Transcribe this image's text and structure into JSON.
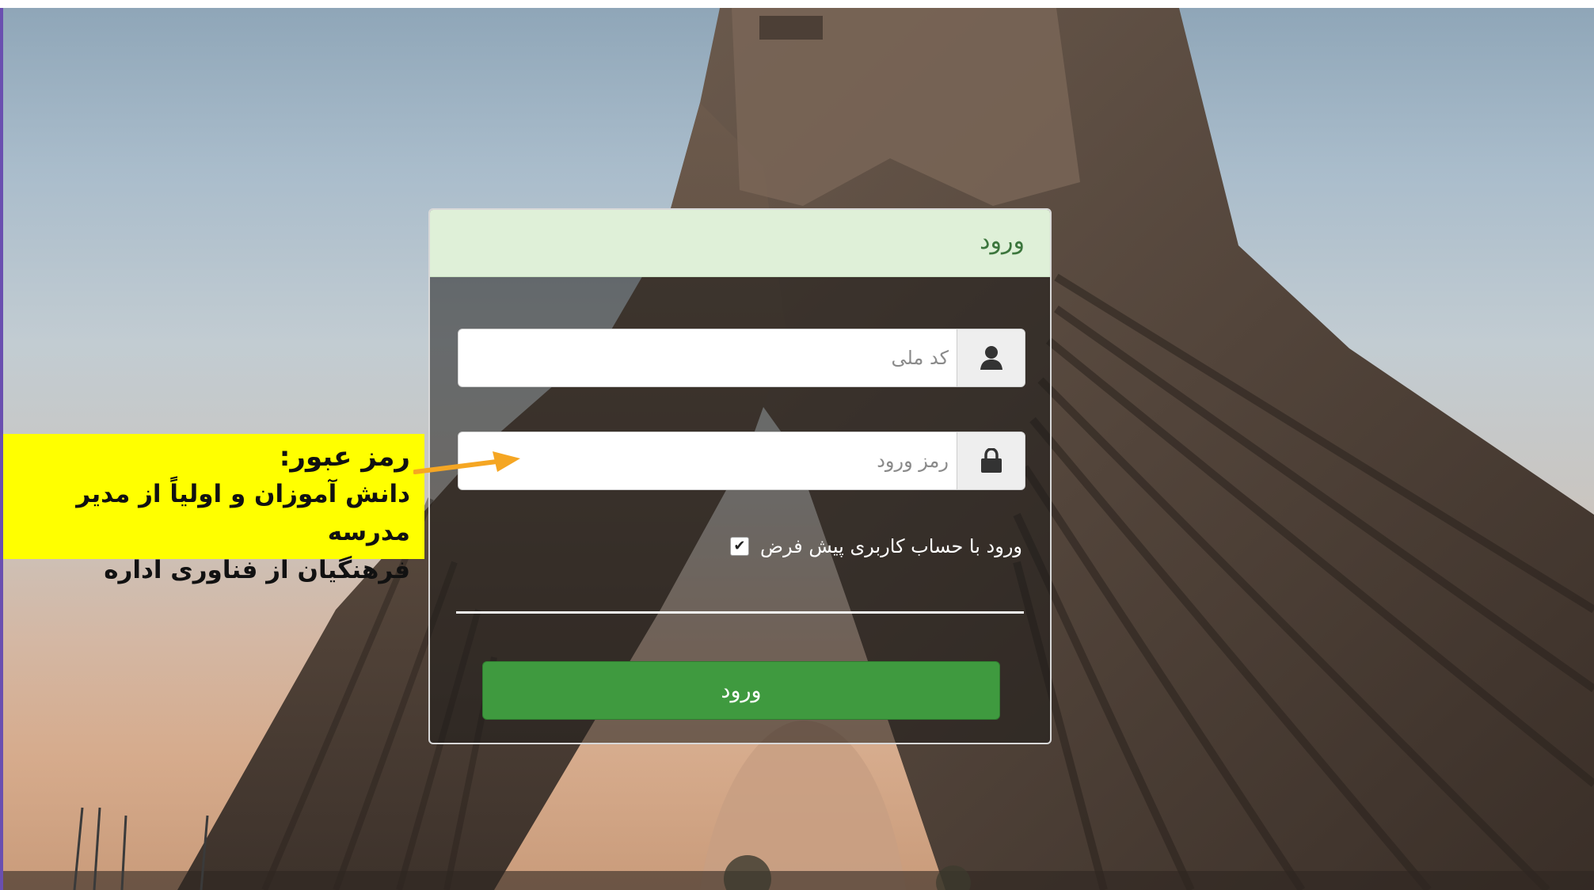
{
  "login": {
    "title": "ورود",
    "national_code_placeholder": "کد ملی",
    "password_placeholder": "رمز ورود",
    "remember_label": "ورود با حساب کاربری پیش فرض",
    "remember_checked": true,
    "submit_label": "ورود"
  },
  "annotation": {
    "line1": "رمز عبور:",
    "line2": "دانش آموزان و اولیاً از مدیر مدرسه",
    "line3": "فرهنگیان از فناوری اداره"
  },
  "colors": {
    "header_bg": "#dff0d8",
    "header_text": "#3c763d",
    "submit_bg": "#3f9a3f",
    "callout_bg": "#ffff00",
    "arrow": "#f5a623"
  },
  "icons": {
    "user_field": "user-icon",
    "password_field": "lock-icon",
    "checkbox": "check-icon"
  }
}
